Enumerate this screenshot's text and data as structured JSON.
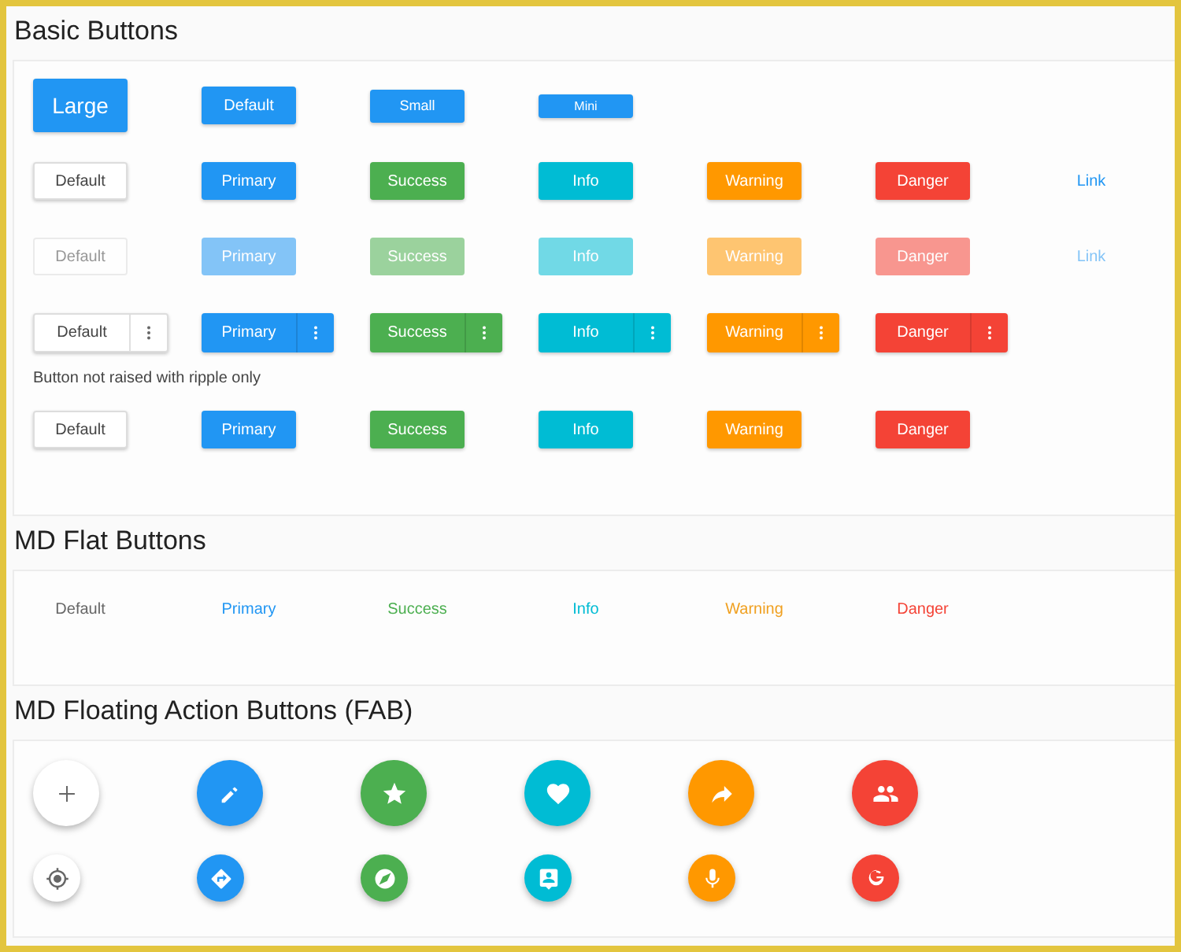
{
  "sections": [
    {
      "title": "Basic Buttons",
      "kind": "buttons",
      "rows": [
        {
          "kind": "sizes",
          "disabled": false,
          "split": false,
          "buttons": [
            {
              "label": "Large"
            },
            {
              "label": "Default"
            },
            {
              "label": "Small"
            },
            {
              "label": "Mini"
            }
          ]
        },
        {
          "kind": "contextual",
          "disabled": false,
          "split": false,
          "buttons": [
            {
              "label": "Default"
            },
            {
              "label": "Primary"
            },
            {
              "label": "Success"
            },
            {
              "label": "Info"
            },
            {
              "label": "Warning"
            },
            {
              "label": "Danger"
            },
            {
              "label": "Link"
            }
          ]
        },
        {
          "kind": "contextual",
          "disabled": true,
          "split": false,
          "buttons": [
            {
              "label": "Default"
            },
            {
              "label": "Primary"
            },
            {
              "label": "Success"
            },
            {
              "label": "Info"
            },
            {
              "label": "Warning"
            },
            {
              "label": "Danger"
            },
            {
              "label": "Link"
            }
          ]
        },
        {
          "kind": "contextual",
          "disabled": false,
          "split": true,
          "buttons": [
            {
              "label": "Default"
            },
            {
              "label": "Primary"
            },
            {
              "label": "Success"
            },
            {
              "label": "Info"
            },
            {
              "label": "Warning"
            },
            {
              "label": "Danger"
            }
          ]
        },
        {
          "kind": "contextual",
          "note": "Button not raised with ripple only",
          "disabled": false,
          "split": false,
          "buttons": [
            {
              "label": "Default"
            },
            {
              "label": "Primary"
            },
            {
              "label": "Success"
            },
            {
              "label": "Info"
            },
            {
              "label": "Warning"
            },
            {
              "label": "Danger"
            }
          ]
        }
      ]
    },
    {
      "title": "MD Flat Buttons",
      "kind": "flat",
      "buttons": [
        {
          "label": "Default"
        },
        {
          "label": "Primary"
        },
        {
          "label": "Success"
        },
        {
          "label": "Info"
        },
        {
          "label": "Warning"
        },
        {
          "label": "Danger"
        }
      ]
    },
    {
      "title": "MD Floating Action Buttons (FAB)",
      "kind": "fab"
    }
  ]
}
